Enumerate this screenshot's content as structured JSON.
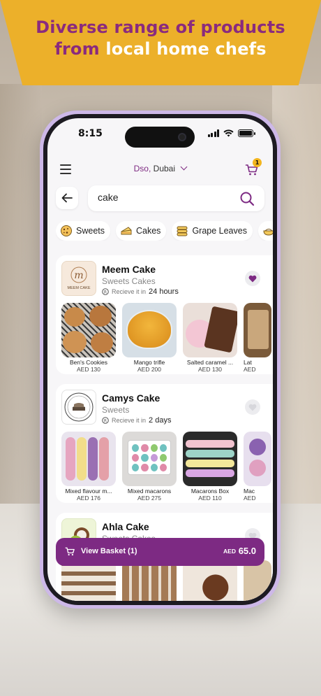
{
  "promo": {
    "line1": "Diverse range of products",
    "line2_a": "from ",
    "line2_b": "local home chefs"
  },
  "status_bar": {
    "time": "8:15"
  },
  "header": {
    "location_area": "Dso,",
    "location_city": "Dubai",
    "cart_count": "1"
  },
  "search": {
    "value": "cake",
    "placeholder": "Search"
  },
  "categories": [
    {
      "label": "Sweets",
      "icon": "cookie-icon"
    },
    {
      "label": "Cakes",
      "icon": "cake-icon"
    },
    {
      "label": "Grape Leaves",
      "icon": "grape-leaves-icon"
    },
    {
      "label": "",
      "icon": "dish-icon"
    }
  ],
  "stores": [
    {
      "name": "Meem Cake",
      "categories": "Sweets Cakes",
      "eta_prefix": "Recieve it in",
      "eta_value": "24 hours",
      "favorited": true,
      "logo_text": "MEEM CAKE",
      "products": [
        {
          "name": "Ben's Cookies",
          "price": "AED 130"
        },
        {
          "name": "Mango trifle",
          "price": "AED 200"
        },
        {
          "name": "Salted caramel ...",
          "price": "AED 130"
        },
        {
          "name": "Lat",
          "price": "AED"
        }
      ]
    },
    {
      "name": "Camys Cake",
      "categories": "Sweets",
      "eta_prefix": "Recieve it in",
      "eta_value": "2 days",
      "favorited": false,
      "products": [
        {
          "name": "Mixed flavour m...",
          "price": "AED 176"
        },
        {
          "name": "Mixed macarons",
          "price": "AED 275"
        },
        {
          "name": "Macarons Box",
          "price": "AED 110"
        },
        {
          "name": "Mac",
          "price": "AED"
        }
      ]
    },
    {
      "name": "Ahla Cake",
      "categories": "Sweets Cakes",
      "favorited": false,
      "products": []
    }
  ],
  "basket": {
    "label": "View Basket (1)",
    "currency": "AED",
    "amount": "65.0"
  },
  "colors": {
    "brand_purple": "#7d2a83",
    "banner_yellow": "#ecb02a",
    "badge_yellow": "#f3b51e"
  }
}
